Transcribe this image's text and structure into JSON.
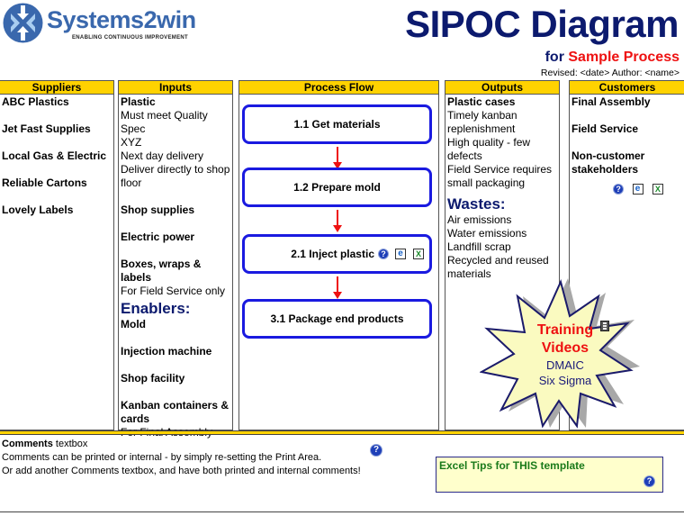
{
  "logo": {
    "name": "Systems2win",
    "tagline": "ENABLING CONTINUOUS IMPROVEMENT",
    "colors": {
      "brand": "#3a68ad",
      "light": "#a9cdf0"
    }
  },
  "header": {
    "title": "SIPOC Diagram",
    "subtitle_prefix": "for",
    "process_name": "Sample Process",
    "revised": "Revised: <date>  Author: <name>"
  },
  "columns": {
    "suppliers": {
      "title": "Suppliers",
      "items": [
        "ABC Plastics",
        "Jet Fast Supplies",
        "Local Gas & Electric",
        "Reliable Cartons",
        "Lovely Labels"
      ]
    },
    "inputs": {
      "title": "Inputs",
      "items": [
        {
          "name": "Plastic",
          "details": [
            "Must meet Quality Spec",
            "XYZ",
            "Next day delivery",
            "Deliver directly to shop",
            "floor"
          ]
        },
        {
          "name": "Shop supplies",
          "details": []
        },
        {
          "name": "Electric power",
          "details": []
        },
        {
          "name": "Boxes, wraps & labels",
          "details": [
            "For Field Service only"
          ]
        }
      ],
      "enablers_title": "Enablers:",
      "enablers": [
        {
          "name": "Mold",
          "details": []
        },
        {
          "name": "Injection machine",
          "details": []
        },
        {
          "name": "Shop facility",
          "details": []
        },
        {
          "name": "Kanban containers &",
          "name2": "cards",
          "details": [
            "For Final Assembly"
          ]
        }
      ]
    },
    "process": {
      "title": "Process Flow",
      "steps": [
        "1.1 Get materials",
        "1.2 Prepare mold",
        "2.1 Inject plastic",
        "3.1 Package end products"
      ]
    },
    "outputs": {
      "title": "Outputs",
      "name": "Plastic cases",
      "details": [
        "Timely kanban",
        "replenishment",
        "High quality - few",
        "defects",
        "Field Service requires",
        "small packaging"
      ],
      "wastes_title": "Wastes:",
      "wastes": [
        "Air emissions",
        "Water emissions",
        "Landfill scrap",
        "Recycled and reused",
        "materials"
      ]
    },
    "customers": {
      "title": "Customers",
      "items": [
        "Final Assembly",
        "Field Service",
        "Non-customer",
        "stakeholders"
      ]
    }
  },
  "icons": {
    "help": "?",
    "ie": "e",
    "excel": "X"
  },
  "training": {
    "line1": "Training",
    "line2": "Videos",
    "line3": "DMAIC",
    "line4": "Six Sigma"
  },
  "comments": {
    "label": "Comments",
    "label_suffix": " textbox",
    "line1": "Comments can be printed or internal - by simply re-setting the Print Area.",
    "line2": "Or add another Comments textbox, and have both printed and internal comments!"
  },
  "tips": {
    "label": "Excel Tips for THIS template"
  },
  "colors": {
    "header_fill": "#ffd200",
    "title_navy": "#0c1a6e",
    "accent_red": "#ee1111",
    "step_border": "#1a1ae0",
    "tips_green": "#1a7a1a",
    "tips_fill": "#ffffcc"
  }
}
